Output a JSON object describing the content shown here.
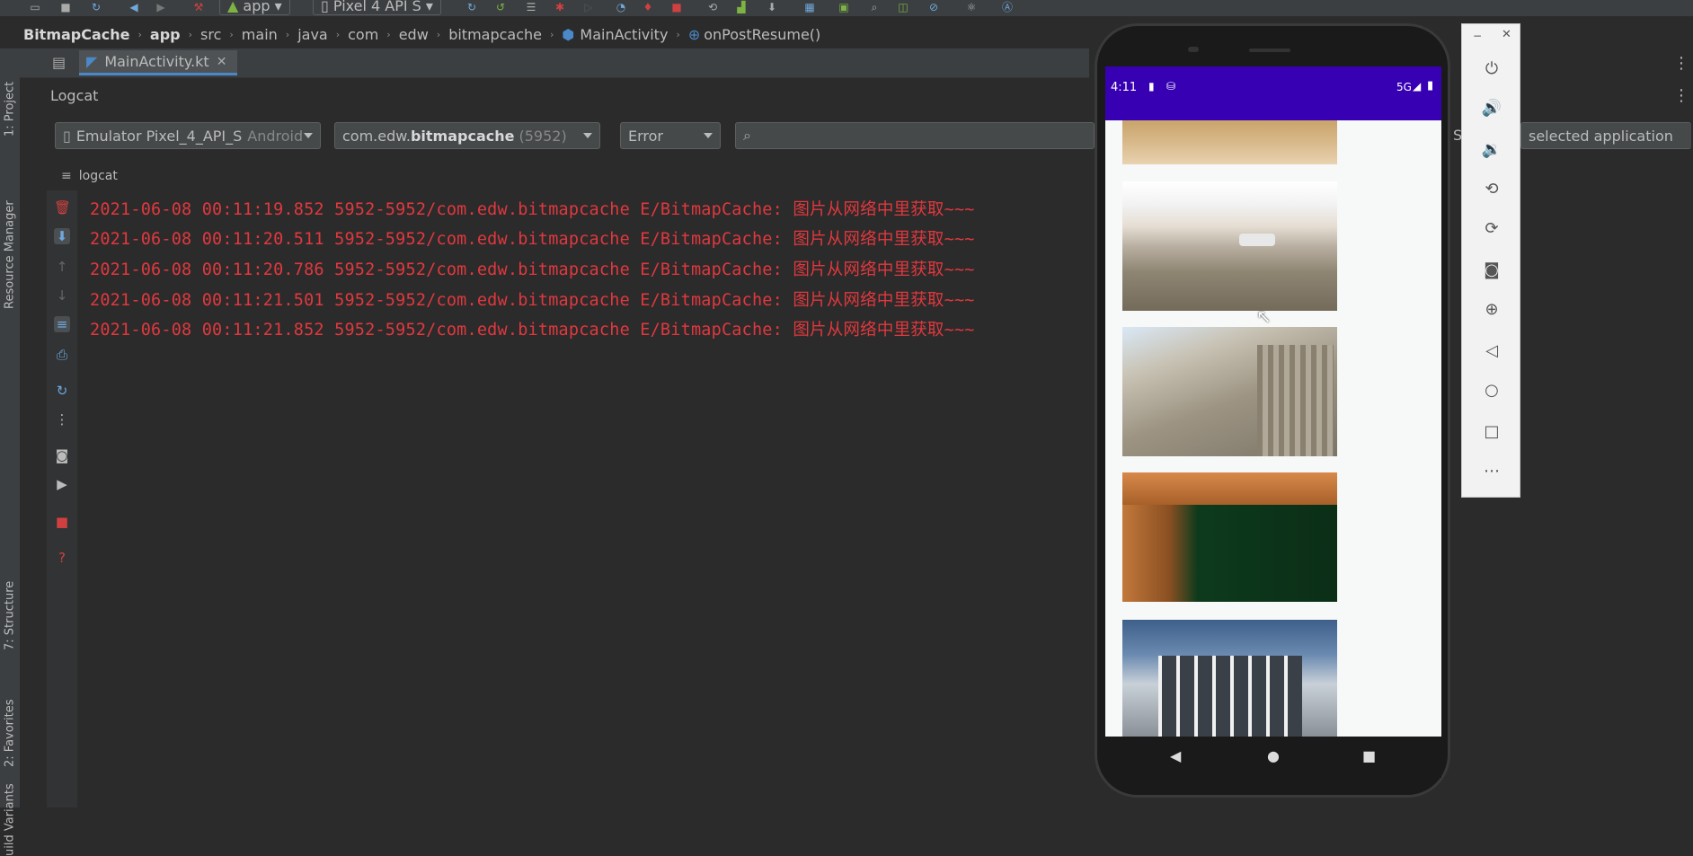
{
  "toolbar": {
    "module": "app",
    "device": "Pixel 4 API S"
  },
  "breadcrumb": [
    "BitmapCache",
    "app",
    "src",
    "main",
    "java",
    "com",
    "edw",
    "bitmapcache",
    "MainActivity",
    "onPostResume()"
  ],
  "tool_windows": {
    "project": "1: Project",
    "resource_manager": "Resource Manager",
    "structure": "7: Structure",
    "favorites": "2: Favorites",
    "build_variants": "uild Variants"
  },
  "editor_tab": {
    "label": "MainActivity.kt"
  },
  "logcat": {
    "title": "Logcat",
    "device_name": "Emulator Pixel_4_API_S",
    "device_suffix": "Android",
    "process_prefix": "com.edw.",
    "process_bold": "bitmapcache",
    "process_pid": "(5952)",
    "level": "Error",
    "search_placeholder": "",
    "right_hint": "S",
    "right_hint_tail": "selected application",
    "sub_tab": "logcat",
    "lines": [
      "2021-06-08 00:11:19.852 5952-5952/com.edw.bitmapcache E/BitmapCache: 图片从网络中里获取~~~",
      "2021-06-08 00:11:20.511 5952-5952/com.edw.bitmapcache E/BitmapCache: 图片从网络中里获取~~~",
      "2021-06-08 00:11:20.786 5952-5952/com.edw.bitmapcache E/BitmapCache: 图片从网络中里获取~~~",
      "2021-06-08 00:11:21.501 5952-5952/com.edw.bitmapcache E/BitmapCache: 图片从网络中里获取~~~",
      "2021-06-08 00:11:21.852 5952-5952/com.edw.bitmapcache E/BitmapCache: 图片从网络中里获取~~~"
    ]
  },
  "phone": {
    "time": "4:11",
    "network": "5G",
    "statusbar_color": "#3700b3"
  },
  "emulator_controls": [
    "power-icon",
    "volume-up-icon",
    "volume-down-icon",
    "rotate-left-icon",
    "rotate-right-icon",
    "camera-icon",
    "zoom-icon",
    "back-icon",
    "home-icon",
    "overview-icon",
    "more-icon"
  ],
  "colors": {
    "log_error": "#e0383e",
    "accent": "#4a88c7"
  }
}
